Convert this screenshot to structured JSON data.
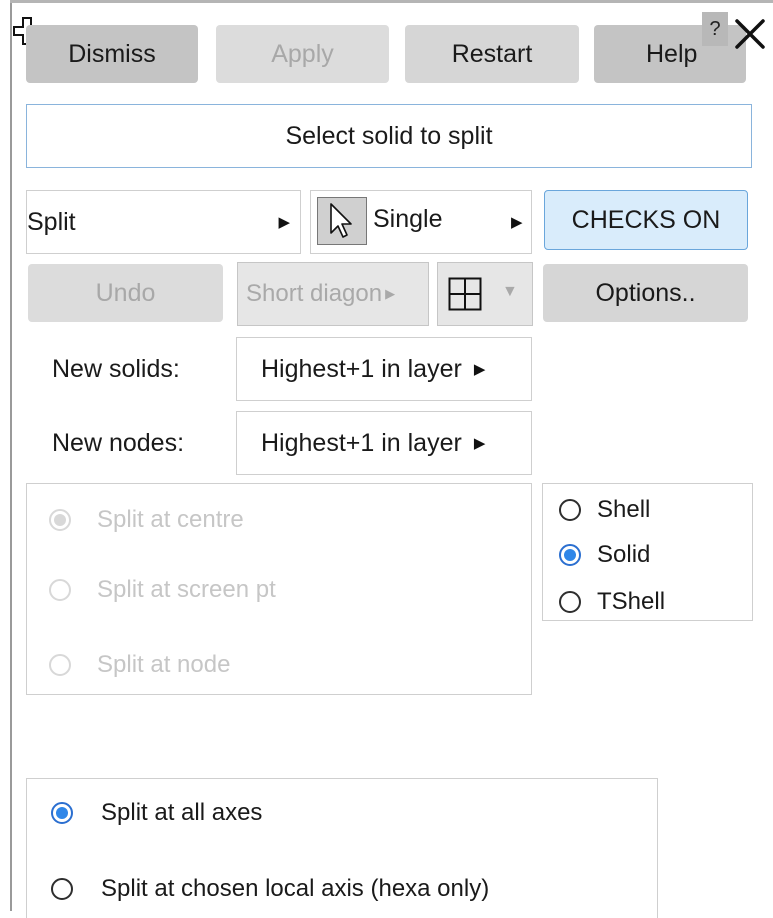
{
  "window": {
    "help_glyph": "?",
    "move_icon": "move-cross-icon",
    "close_icon": "close-icon"
  },
  "toolbar": {
    "dismiss": "Dismiss",
    "apply": "Apply",
    "restart": "Restart",
    "help": "Help"
  },
  "prompt": "Select solid to split",
  "mode_row": {
    "split_menu": "Split",
    "pick_mode": "Single",
    "checks": "CHECKS ON"
  },
  "action_row": {
    "undo": "Undo",
    "diagonal": "Short diagon",
    "options": "Options.."
  },
  "numbering": {
    "solids_label": "New solids:",
    "solids_value": "Highest+1 in layer",
    "nodes_label": "New nodes:",
    "nodes_value": "Highest+1 in layer"
  },
  "split_location": [
    {
      "label": "Split at centre",
      "selected": true,
      "enabled": false
    },
    {
      "label": "Split at screen pt",
      "selected": false,
      "enabled": false
    },
    {
      "label": "Split at node",
      "selected": false,
      "enabled": false
    }
  ],
  "element_type": [
    {
      "label": "Shell",
      "selected": false
    },
    {
      "label": "Solid",
      "selected": true
    },
    {
      "label": "TShell",
      "selected": false
    }
  ],
  "axis_options": [
    {
      "label": "Split at all axes",
      "selected": true
    },
    {
      "label": "Split at chosen local axis (hexa only)",
      "selected": false
    }
  ],
  "colors": {
    "accent": "#2f86e8",
    "checks_bg": "#d9ecfb",
    "prompt_border": "#8ab4dc"
  }
}
